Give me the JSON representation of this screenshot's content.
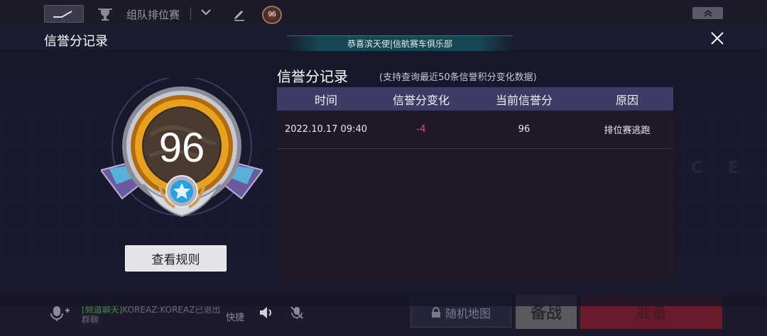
{
  "topbar": {
    "mode_label": "组队排位赛",
    "badge_score": "96"
  },
  "modal": {
    "title": "信誉分记录",
    "announcement": "恭喜滨天使|信航赛车俱乐部",
    "rule_button_label": "查看规则"
  },
  "badge": {
    "score": "96"
  },
  "records": {
    "title": "信誉分记录",
    "subtitle": "(支持查询最近50条信誉积分变化数据)",
    "columns": [
      "时间",
      "信誉分变化",
      "当前信誉分",
      "原因"
    ],
    "rows": [
      {
        "time": "2022.10.17 09:40",
        "change": "-4",
        "current": "96",
        "reason": "排位赛逃跑"
      }
    ]
  },
  "bottombar": {
    "chat_tag": "[频道聊天]",
    "chat_text": "KOREAZ:KOREAZ已退出群聊",
    "quick_label": "快捷",
    "map_label": "随机地图",
    "prep_label": "备战",
    "ready_label": "准备"
  },
  "colors": {
    "negative_change": "#e0506a",
    "table_header": "#3c3c66",
    "badge_gold": "#e8a020"
  },
  "icons": [
    "track-icon",
    "trophy-icon",
    "chevron-down-icon",
    "edit-icon",
    "collapse-icon",
    "close-icon",
    "mic-icon",
    "speaker-icon",
    "mute-icon",
    "lock-icon",
    "star-icon"
  ]
}
